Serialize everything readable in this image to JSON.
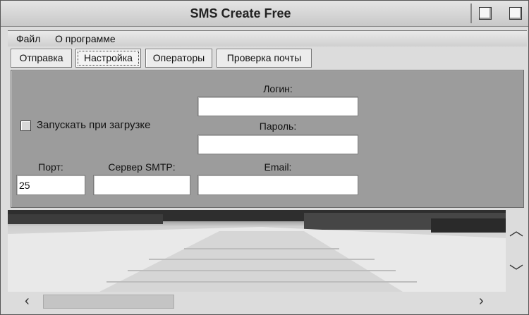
{
  "window": {
    "title": "SMS Create Free"
  },
  "menu": {
    "items": [
      "Файл",
      "О программе"
    ]
  },
  "tabs": [
    "Отправка",
    "Настройка",
    "Операторы",
    "Проверка почты"
  ],
  "active_tab": "Настройка",
  "settings": {
    "autostart_label": "Запускать при загрузке",
    "autostart_checked": false,
    "login_label": "Логин:",
    "login_value": "",
    "password_label": "Пароль:",
    "password_value": "",
    "port_label": "Порт:",
    "port_value": "25",
    "smtp_label": "Сервер SMTP:",
    "smtp_value": "",
    "email_label": "Email:",
    "email_value": ""
  },
  "scroll": {
    "up_icon": "chevron-up-icon",
    "down_icon": "chevron-down-icon",
    "left_icon": "chevron-left-icon",
    "right_icon": "chevron-right-icon"
  }
}
